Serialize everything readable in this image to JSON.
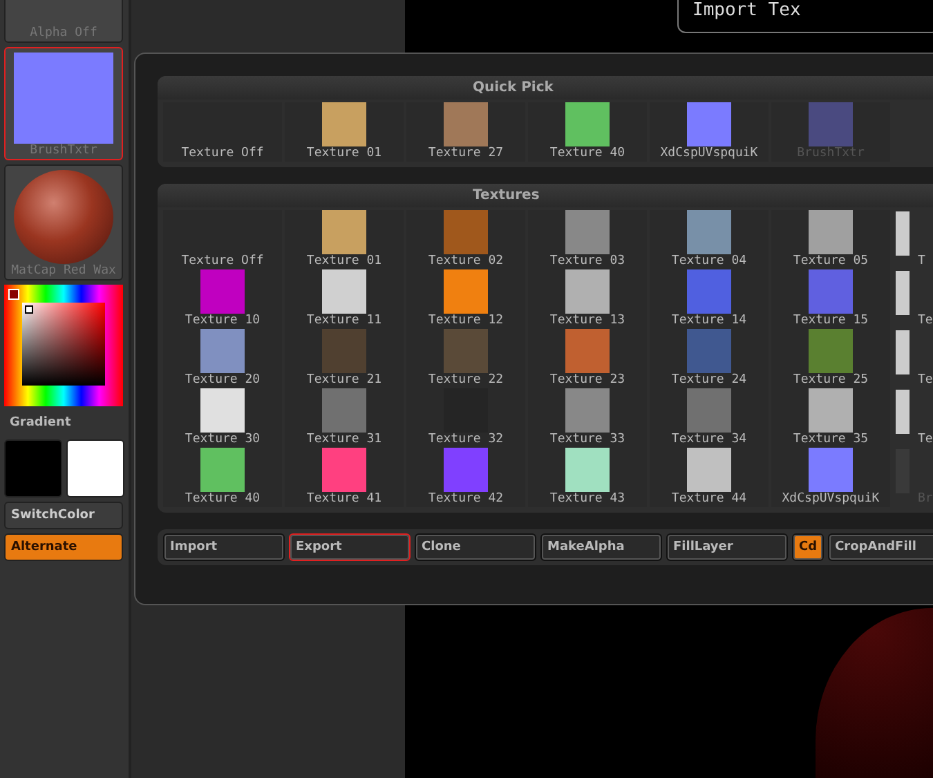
{
  "header": {
    "title": "Import Tex"
  },
  "sidebar": {
    "tiles": [
      {
        "kind": "alpha",
        "label": "Alpha Off",
        "selected": false
      },
      {
        "kind": "texture",
        "label": "BrushTxtr",
        "selected": true,
        "color": "#7b7bff"
      },
      {
        "kind": "material",
        "label": "MatCap Red Wax",
        "selected": false
      }
    ],
    "gradient_label": "Gradient",
    "swatches": [
      {
        "color": "#000000"
      },
      {
        "color": "#ffffff"
      }
    ],
    "buttons": [
      {
        "label": "SwitchColor",
        "on": false
      },
      {
        "label": "Alternate",
        "on": true
      }
    ]
  },
  "quick_pick": {
    "title": "Quick Pick",
    "items": [
      {
        "label": "Texture Off",
        "disabled": false
      },
      {
        "label": "Texture 01",
        "color": "#c8a060",
        "disabled": false
      },
      {
        "label": "Texture 27",
        "color": "#a07858",
        "disabled": false
      },
      {
        "label": "Texture 40",
        "color": "#60c060",
        "disabled": false
      },
      {
        "label": "XdCspUVspquiK",
        "color": "#7b7bff",
        "disabled": false
      },
      {
        "label": "BrushTxtr",
        "color": "#4a4a80",
        "disabled": true
      }
    ]
  },
  "textures": {
    "title": "Textures",
    "rows": [
      [
        {
          "label": "Texture Off",
          "disabled": false
        },
        {
          "label": "Texture 01",
          "color": "#c8a060",
          "disabled": false
        },
        {
          "label": "Texture 02",
          "color": "#a0581c",
          "disabled": false
        },
        {
          "label": "Texture 03",
          "color": "#888888",
          "disabled": false
        },
        {
          "label": "Texture 04",
          "color": "#7890a8",
          "disabled": false
        },
        {
          "label": "Texture 05",
          "color": "#a0a0a0",
          "disabled": false
        },
        {
          "label": "T",
          "color": "#cccccc",
          "disabled": false
        }
      ],
      [
        {
          "label": "Texture 10",
          "color": "#c000c0",
          "disabled": false
        },
        {
          "label": "Texture 11",
          "color": "#d0d0d0",
          "disabled": false
        },
        {
          "label": "Texture 12",
          "color": "#f08010",
          "disabled": false
        },
        {
          "label": "Texture 13",
          "color": "#b0b0b0",
          "disabled": false
        },
        {
          "label": "Texture 14",
          "color": "#5060e0",
          "disabled": false
        },
        {
          "label": "Texture 15",
          "color": "#6060e0",
          "disabled": false
        },
        {
          "label": "Te",
          "color": "#cccccc",
          "disabled": false
        }
      ],
      [
        {
          "label": "Texture 20",
          "color": "#8090c0",
          "disabled": false
        },
        {
          "label": "Texture 21",
          "color": "#504030",
          "disabled": false
        },
        {
          "label": "Texture 22",
          "color": "#5a4a38",
          "disabled": false
        },
        {
          "label": "Texture 23",
          "color": "#c06030",
          "disabled": false
        },
        {
          "label": "Texture 24",
          "color": "#405890",
          "disabled": false
        },
        {
          "label": "Texture 25",
          "color": "#5a8030",
          "disabled": false
        },
        {
          "label": "Te",
          "color": "#cccccc",
          "disabled": false
        }
      ],
      [
        {
          "label": "Texture 30",
          "color": "#e0e0e0",
          "disabled": false
        },
        {
          "label": "Texture 31",
          "color": "#707070",
          "disabled": false
        },
        {
          "label": "Texture 32",
          "color": "#252525",
          "disabled": false
        },
        {
          "label": "Texture 33",
          "color": "#888888",
          "disabled": false
        },
        {
          "label": "Texture 34",
          "color": "#707070",
          "disabled": false
        },
        {
          "label": "Texture 35",
          "color": "#b0b0b0",
          "disabled": false
        },
        {
          "label": "Te",
          "color": "#cccccc",
          "disabled": false
        }
      ],
      [
        {
          "label": "Texture 40",
          "color": "#60c060",
          "disabled": false
        },
        {
          "label": "Texture 41",
          "color": "#ff4080",
          "disabled": false
        },
        {
          "label": "Texture 42",
          "color": "#8040ff",
          "disabled": false
        },
        {
          "label": "Texture 43",
          "color": "#a0e0c0",
          "disabled": false
        },
        {
          "label": "Texture 44",
          "color": "#c0c0c0",
          "disabled": false
        },
        {
          "label": "XdCspUVspquiK",
          "color": "#7b7bff",
          "disabled": false
        },
        {
          "label": "Br",
          "color": "#3a3a3a",
          "disabled": true
        }
      ]
    ]
  },
  "actions": [
    {
      "label": "Import",
      "selected": false,
      "on": false
    },
    {
      "label": "Export",
      "selected": true,
      "on": false
    },
    {
      "label": "Clone",
      "selected": false,
      "on": false
    },
    {
      "label": "MakeAlpha",
      "selected": false,
      "on": false
    },
    {
      "label": "FillLayer",
      "selected": false,
      "on": false
    },
    {
      "label": "Cd",
      "selected": false,
      "on": true
    },
    {
      "label": "CropAndFill",
      "selected": false,
      "on": false
    }
  ]
}
